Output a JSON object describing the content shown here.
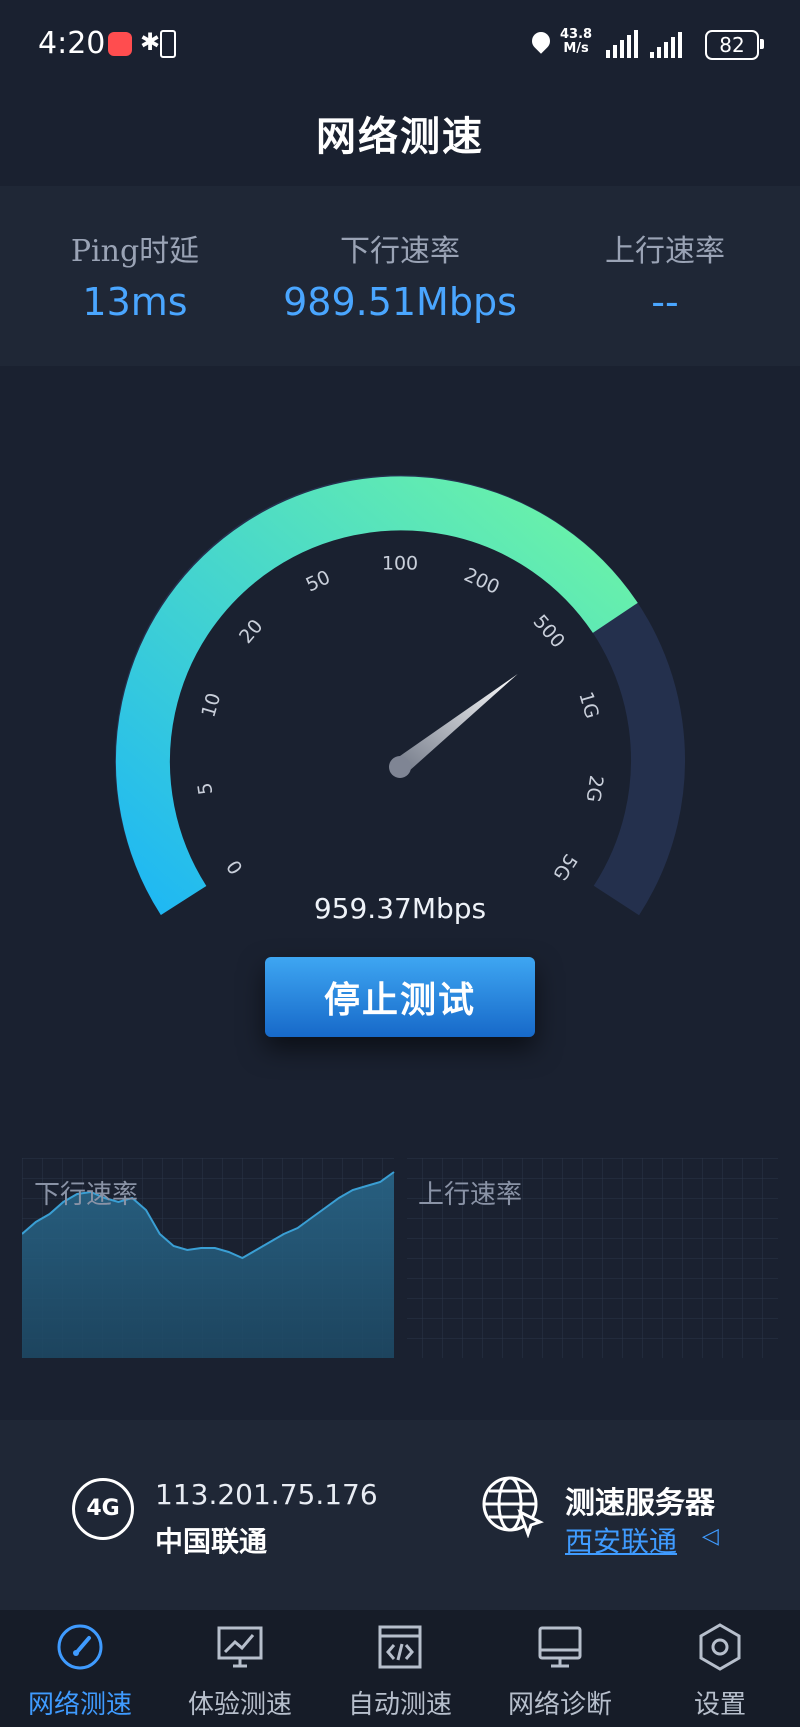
{
  "status_bar": {
    "time": "4:20",
    "net_speed_value": "43.8",
    "net_speed_unit": "M/s",
    "battery": "82"
  },
  "header": {
    "title": "网络测速"
  },
  "stats": [
    {
      "label": "Ping时延",
      "value": "13ms"
    },
    {
      "label": "下行速率",
      "value": "989.51Mbps"
    },
    {
      "label": "上行速率",
      "value": "--"
    }
  ],
  "gauge": {
    "tick_labels": [
      "0",
      "5",
      "10",
      "20",
      "50",
      "100",
      "200",
      "500",
      "1G",
      "2G",
      "5G"
    ],
    "progress_fraction": 0.73,
    "needle_fraction": 0.71,
    "current_speed": "959.37Mbps",
    "colors": {
      "arc_start": "#1fb8f3",
      "arc_end": "#6ef5a5",
      "track": "#24304d"
    }
  },
  "actions": {
    "stop_label": "停止测试"
  },
  "graphs": {
    "download_label": "下行速率",
    "upload_label": "上行速率",
    "download_samples": [
      0.62,
      0.68,
      0.72,
      0.78,
      0.82,
      0.83,
      0.8,
      0.78,
      0.8,
      0.74,
      0.62,
      0.56,
      0.54,
      0.55,
      0.55,
      0.53,
      0.5,
      0.54,
      0.58,
      0.62,
      0.65,
      0.7,
      0.75,
      0.8,
      0.84,
      0.86,
      0.88,
      0.93
    ]
  },
  "info": {
    "network_type": "4G",
    "ip": "113.201.75.176",
    "carrier": "中国联通",
    "server_label": "测速服务器",
    "server_name": "西安联通"
  },
  "tabs": [
    {
      "label": "网络测速",
      "icon": "speedometer-icon",
      "active": true
    },
    {
      "label": "体验测速",
      "icon": "chart-monitor-icon",
      "active": false
    },
    {
      "label": "自动测速",
      "icon": "code-window-icon",
      "active": false
    },
    {
      "label": "网络诊断",
      "icon": "monitor-icon",
      "active": false
    },
    {
      "label": "设置",
      "icon": "settings-hexagon-icon",
      "active": false
    }
  ]
}
